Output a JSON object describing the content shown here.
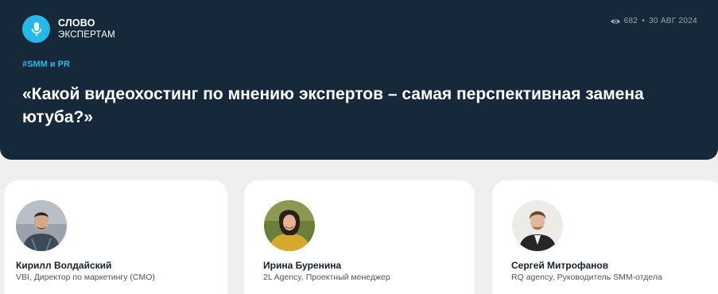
{
  "logo": {
    "line1": "СЛОВО",
    "line2": "ЭКСПЕРТАМ",
    "icon": "microphone-icon",
    "color": "#27b7ea"
  },
  "meta": {
    "views": "682",
    "separator": "•",
    "date": "30 АВГ 2024",
    "icon": "eye-icon"
  },
  "article": {
    "tag": "#SMM и PR",
    "title": "«Какой видеохостинг по мнению экспертов – самая перспективная замена ютуба?»"
  },
  "experts": [
    {
      "name": "Кирилл Волдайский",
      "role": "VBI, Директор по маркетингу (CMO)"
    },
    {
      "name": "Ирина Буренина",
      "role": "2L Agency, Проектный менеджер"
    },
    {
      "name": "Сергей Митрофанов",
      "role": "RQ agency, Руководитель SMM-отдела"
    }
  ],
  "colors": {
    "hero_bg": "#15293a",
    "accent": "#27b7ea",
    "page_bg": "#efefef"
  }
}
